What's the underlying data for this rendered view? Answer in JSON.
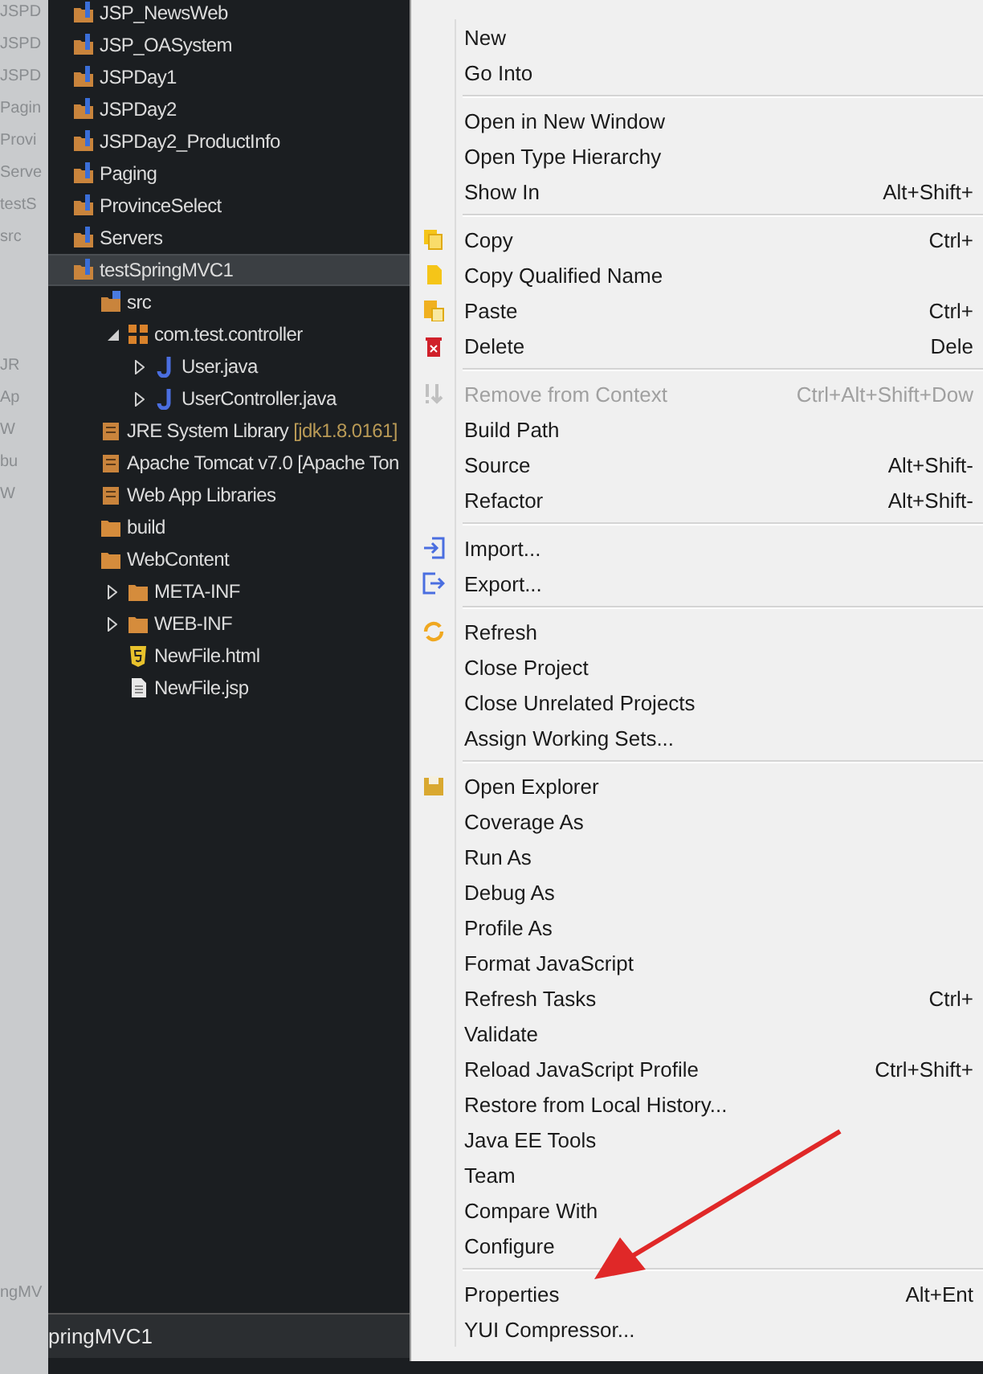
{
  "background_strip": {
    "upper": [
      "JSPD",
      "JSPD",
      "JSPD",
      "Pagin",
      "Provi",
      "Serve",
      "testS",
      "src"
    ],
    "lower": [
      "JR",
      "Ap",
      "W",
      "bu",
      "W"
    ],
    "bottom": "ngMV"
  },
  "tree": [
    {
      "label": "JSP_NewsWeb",
      "kind": "project",
      "selected": false
    },
    {
      "label": "JSP_OASystem",
      "kind": "project",
      "selected": false
    },
    {
      "label": "JSPDay1",
      "kind": "project",
      "selected": false
    },
    {
      "label": "JSPDay2",
      "kind": "project",
      "selected": false
    },
    {
      "label": "JSPDay2_ProductInfo",
      "kind": "project",
      "selected": false
    },
    {
      "label": "Paging",
      "kind": "project",
      "selected": false
    },
    {
      "label": "ProvinceSelect",
      "kind": "project",
      "selected": false
    },
    {
      "label": "Servers",
      "kind": "project",
      "selected": false
    },
    {
      "label": "testSpringMVC1",
      "kind": "project",
      "selected": true,
      "children": [
        {
          "label": "src",
          "kind": "source-folder",
          "selected": false,
          "children": [
            {
              "label": "com.test.controller",
              "kind": "package",
              "selected": false,
              "expanded": true,
              "children": [
                {
                  "label": "User.java",
                  "kind": "java",
                  "selected": false,
                  "expanded": false
                },
                {
                  "label": "UserController.java",
                  "kind": "java",
                  "selected": false,
                  "expanded": false
                }
              ]
            }
          ]
        },
        {
          "label": "JRE System Library",
          "decoration": "[jdk1.8.0161]",
          "kind": "library",
          "selected": false
        },
        {
          "label": "Apache Tomcat v7.0 [Apache Ton",
          "kind": "library",
          "selected": false
        },
        {
          "label": "Web App Libraries",
          "kind": "library",
          "selected": false
        },
        {
          "label": "build",
          "kind": "folder",
          "selected": false
        },
        {
          "label": "WebContent",
          "kind": "folder",
          "selected": false,
          "children": [
            {
              "label": "META-INF",
              "kind": "folder",
              "selected": false,
              "expanded": false
            },
            {
              "label": "WEB-INF",
              "kind": "folder",
              "selected": false,
              "expanded": false
            },
            {
              "label": "NewFile.html",
              "kind": "html",
              "selected": false
            },
            {
              "label": "NewFile.jsp",
              "kind": "file",
              "selected": false
            }
          ]
        }
      ]
    }
  ],
  "status_bar": {
    "text": "pringMVC1"
  },
  "context_menu": [
    {
      "kind": "item",
      "label": "New",
      "disabled": false
    },
    {
      "kind": "item",
      "label": "Go Into",
      "disabled": false
    },
    {
      "kind": "separator"
    },
    {
      "kind": "item",
      "label": "Open in New Window",
      "disabled": false
    },
    {
      "kind": "item",
      "label": "Open Type Hierarchy",
      "disabled": false
    },
    {
      "kind": "item",
      "label": "Show In",
      "shortcut": "Alt+Shift+",
      "disabled": false
    },
    {
      "kind": "separator"
    },
    {
      "kind": "copy",
      "label": "Copy",
      "shortcut": "Ctrl+",
      "disabled": false
    },
    {
      "kind": "copy-name",
      "label": "Copy Qualified Name",
      "disabled": false
    },
    {
      "kind": "paste",
      "label": "Paste",
      "shortcut": "Ctrl+",
      "disabled": false
    },
    {
      "kind": "delete",
      "label": "Delete",
      "shortcut": "Dele",
      "disabled": false
    },
    {
      "kind": "separator"
    },
    {
      "kind": "remove-context",
      "label": "Remove from Context",
      "shortcut": "Ctrl+Alt+Shift+Dow",
      "disabled": true
    },
    {
      "kind": "item",
      "label": "Build Path",
      "disabled": false
    },
    {
      "kind": "item",
      "label": "Source",
      "shortcut": "Alt+Shift-",
      "disabled": false
    },
    {
      "kind": "item",
      "label": "Refactor",
      "shortcut": "Alt+Shift-",
      "disabled": false
    },
    {
      "kind": "separator"
    },
    {
      "kind": "import",
      "label": "Import...",
      "disabled": false
    },
    {
      "kind": "export",
      "label": "Export...",
      "disabled": false
    },
    {
      "kind": "separator"
    },
    {
      "kind": "refresh",
      "label": "Refresh",
      "disabled": false
    },
    {
      "kind": "item",
      "label": "Close Project",
      "disabled": false
    },
    {
      "kind": "item",
      "label": "Close Unrelated Projects",
      "disabled": false
    },
    {
      "kind": "item",
      "label": "Assign Working Sets...",
      "disabled": false
    },
    {
      "kind": "separator"
    },
    {
      "kind": "explorer",
      "label": "Open Explorer",
      "disabled": false
    },
    {
      "kind": "item",
      "label": "Coverage As",
      "disabled": false
    },
    {
      "kind": "item",
      "label": "Run As",
      "disabled": false
    },
    {
      "kind": "item",
      "label": "Debug As",
      "disabled": false
    },
    {
      "kind": "item",
      "label": "Profile As",
      "disabled": false
    },
    {
      "kind": "item",
      "label": "Format JavaScript",
      "disabled": false
    },
    {
      "kind": "item",
      "label": "Refresh Tasks",
      "shortcut": "Ctrl+",
      "disabled": false
    },
    {
      "kind": "item",
      "label": "Validate",
      "disabled": false
    },
    {
      "kind": "item",
      "label": "Reload JavaScript Profile",
      "shortcut": "Ctrl+Shift+",
      "disabled": false
    },
    {
      "kind": "item",
      "label": "Restore from Local History...",
      "disabled": false
    },
    {
      "kind": "item",
      "label": "Java EE Tools",
      "disabled": false
    },
    {
      "kind": "item",
      "label": "Team",
      "disabled": false
    },
    {
      "kind": "item",
      "label": "Compare With",
      "disabled": false
    },
    {
      "kind": "item",
      "label": "Configure",
      "disabled": false
    },
    {
      "kind": "separator"
    },
    {
      "kind": "item",
      "label": "Properties",
      "shortcut": "Alt+Ent",
      "disabled": false
    },
    {
      "kind": "item",
      "label": "YUI Compressor...",
      "disabled": false
    }
  ]
}
